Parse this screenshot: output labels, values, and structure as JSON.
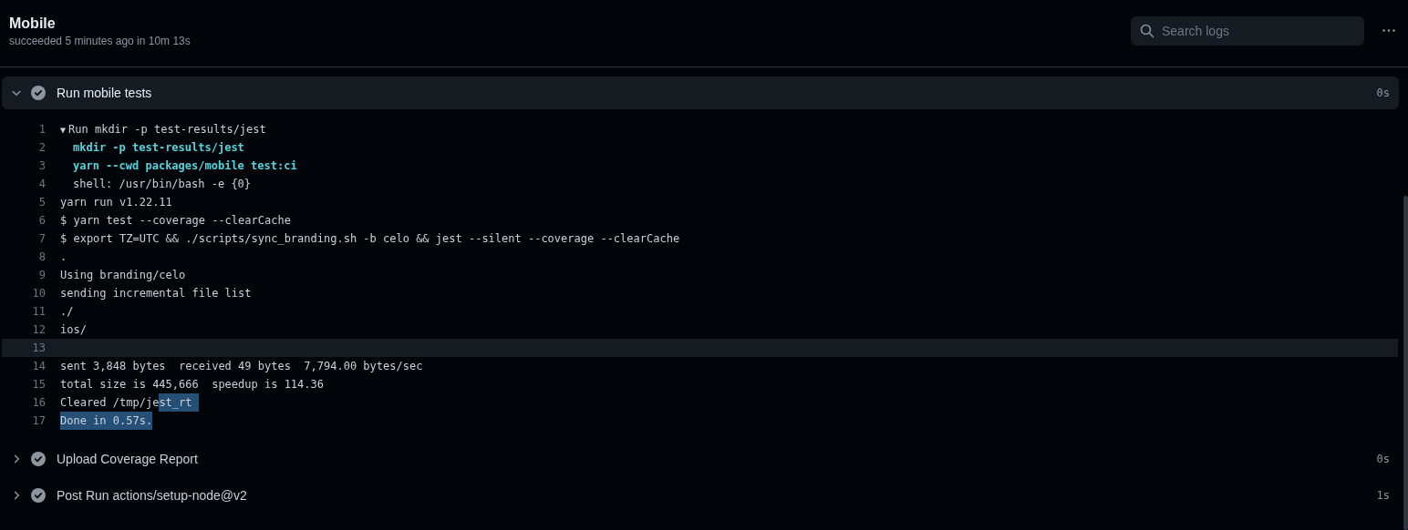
{
  "job": {
    "title": "Mobile",
    "summary": "succeeded 5 minutes ago in 10m 13s"
  },
  "search": {
    "placeholder": "Search logs"
  },
  "steps": [
    {
      "name": "Run mobile tests",
      "duration": "0s",
      "expanded": true,
      "log": [
        {
          "number": "1",
          "kind": "group",
          "toggle": "▼",
          "text": "Run mkdir -p test-results/jest",
          "highlighted": false,
          "children": [
            {
              "number": "2",
              "kind": "command",
              "text": "mkdir -p test-results/jest",
              "highlighted": false
            },
            {
              "number": "3",
              "kind": "command",
              "text": "yarn --cwd packages/mobile test:ci",
              "highlighted": false
            },
            {
              "number": "4",
              "kind": "plain",
              "text": "shell: /usr/bin/bash -e {0}",
              "highlighted": false
            }
          ]
        },
        {
          "number": "5",
          "kind": "plain",
          "text": "yarn run v1.22.11",
          "highlighted": false
        },
        {
          "number": "6",
          "kind": "plain",
          "text": "$ yarn test --coverage --clearCache",
          "highlighted": false
        },
        {
          "number": "7",
          "kind": "plain",
          "text": "$ export TZ=UTC && ./scripts/sync_branding.sh -b celo && jest --silent --coverage --clearCache",
          "highlighted": false
        },
        {
          "number": "8",
          "kind": "plain",
          "text": ".",
          "highlighted": false
        },
        {
          "number": "9",
          "kind": "plain",
          "text": "Using branding/celo",
          "highlighted": false
        },
        {
          "number": "10",
          "kind": "plain",
          "text": "sending incremental file list",
          "highlighted": false
        },
        {
          "number": "11",
          "kind": "plain",
          "text": "./",
          "highlighted": false
        },
        {
          "number": "12",
          "kind": "plain",
          "text": "ios/",
          "highlighted": false
        },
        {
          "number": "13",
          "kind": "plain",
          "highlighted": true
        },
        {
          "number": "14",
          "kind": "plain",
          "text": "sent 3,848 bytes  received 49 bytes  7,794.00 bytes/sec",
          "highlighted": false
        },
        {
          "number": "15",
          "kind": "plain",
          "text": "total size is 445,666  speedup is 114.36",
          "highlighted": false
        },
        {
          "number": "16",
          "kind": "segmented",
          "highlighted": false,
          "segments": [
            {
              "text": "Cleared /tmp/je",
              "selected": false
            },
            {
              "text": "st_rt ",
              "selected": true
            }
          ]
        },
        {
          "number": "17",
          "kind": "segmented",
          "highlighted": false,
          "segments": [
            {
              "text": "Done in 0.57s.",
              "selected": true
            }
          ]
        }
      ]
    },
    {
      "name": "Upload Coverage Report",
      "duration": "0s",
      "expanded": false
    },
    {
      "name": "Post Run actions/setup-node@v2",
      "duration": "1s",
      "expanded": false
    }
  ]
}
